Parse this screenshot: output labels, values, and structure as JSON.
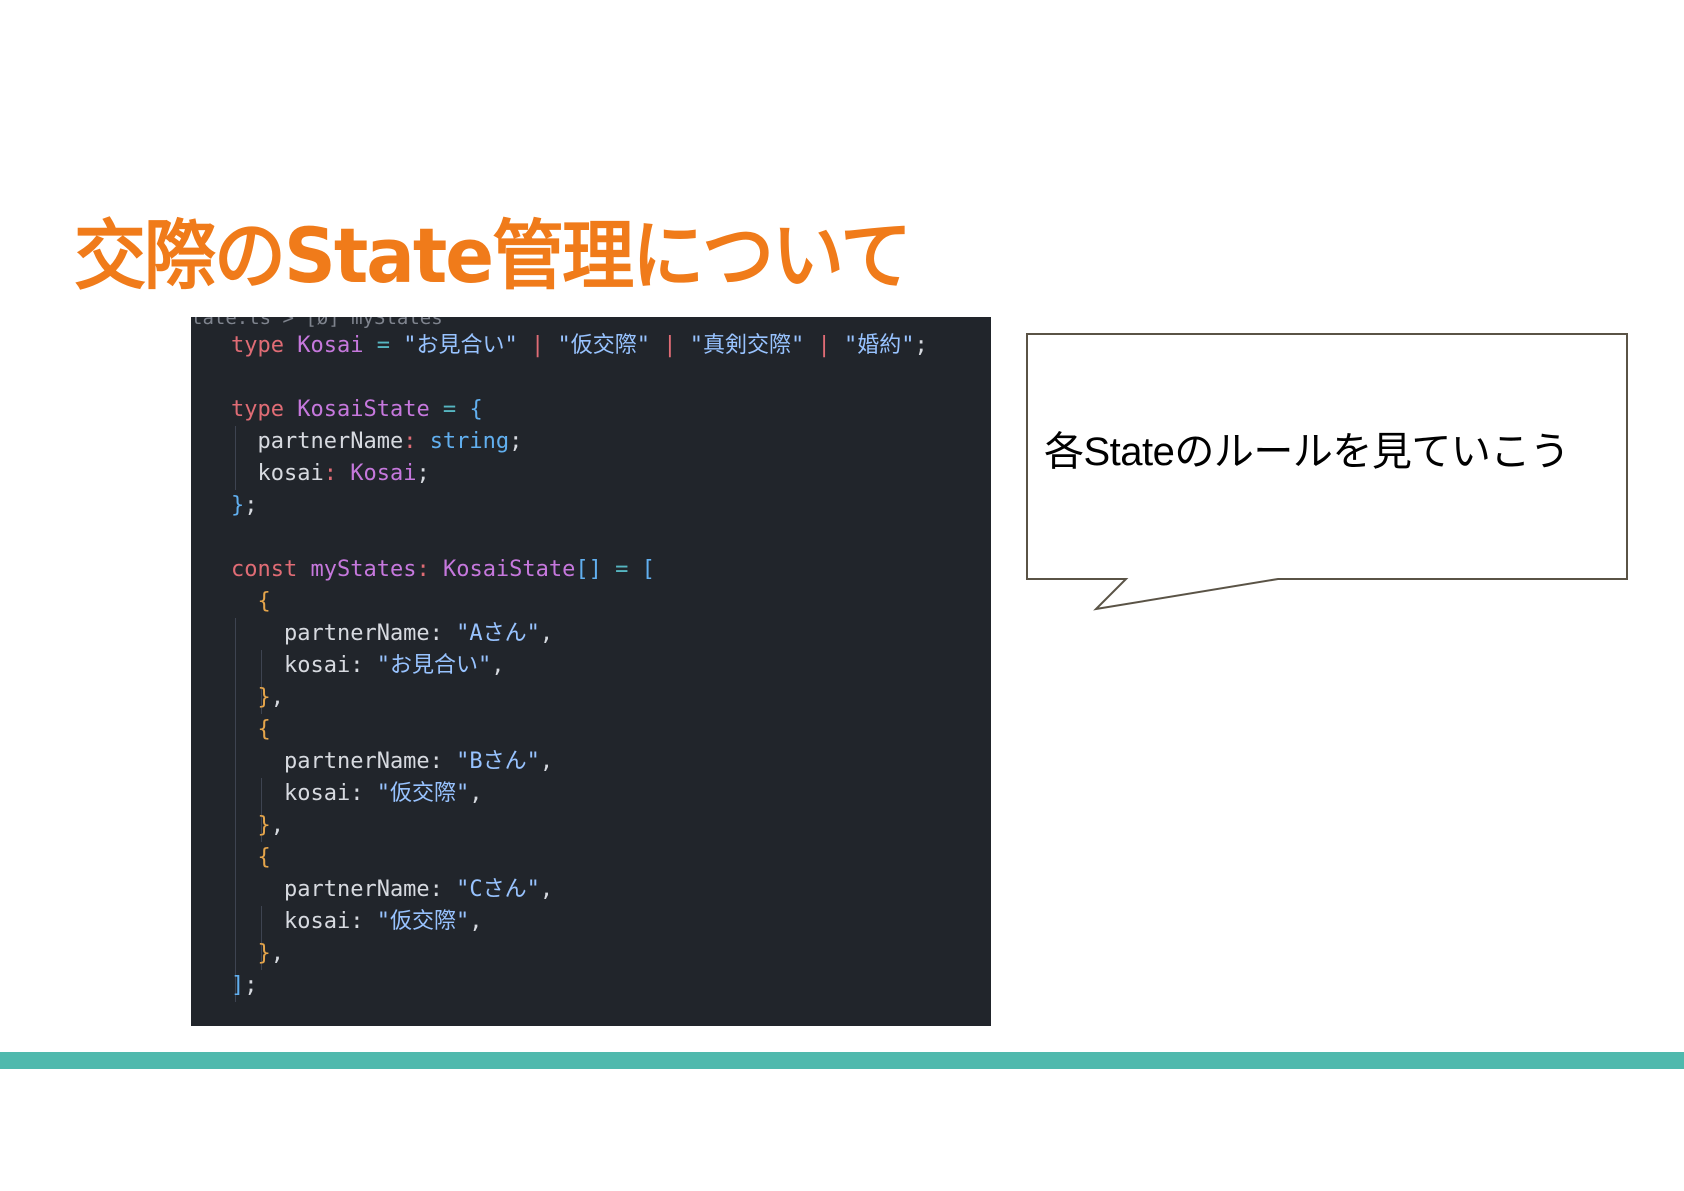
{
  "slide": {
    "title": "交際のState管理について",
    "callout_text": "各Stateのルールを見ていこう"
  },
  "code": {
    "breadcrumb": "tate.ts > [ø] myStates",
    "lines": [
      [
        [
          "type ",
          "#e06c75"
        ],
        [
          "Kosai",
          "#c678dd"
        ],
        [
          " = ",
          "#56b6c2"
        ],
        [
          "\"お見合い\"",
          "#98c3ff"
        ],
        [
          " | ",
          "#e06c75"
        ],
        [
          "\"仮交際\"",
          "#98c3ff"
        ],
        [
          " | ",
          "#e06c75"
        ],
        [
          "\"真剣交際\"",
          "#98c3ff"
        ],
        [
          " | ",
          "#e06c75"
        ],
        [
          "\"婚約\"",
          "#98c3ff"
        ],
        [
          ";",
          "#d7dae0"
        ]
      ],
      [],
      [
        [
          "type ",
          "#e06c75"
        ],
        [
          "KosaiState",
          "#c678dd"
        ],
        [
          " = ",
          "#56b6c2"
        ],
        [
          "{",
          "#61afef"
        ]
      ],
      [
        [
          "  partnerName",
          "#d7dae0"
        ],
        [
          ": ",
          "#e06c75"
        ],
        [
          "string",
          "#61afef"
        ],
        [
          ";",
          "#d7dae0"
        ]
      ],
      [
        [
          "  kosai",
          "#d7dae0"
        ],
        [
          ": ",
          "#e06c75"
        ],
        [
          "Kosai",
          "#c678dd"
        ],
        [
          ";",
          "#d7dae0"
        ]
      ],
      [
        [
          "}",
          "#61afef"
        ],
        [
          ";",
          "#d7dae0"
        ]
      ],
      [],
      [
        [
          "const ",
          "#e06c75"
        ],
        [
          "myStates",
          "#c678dd"
        ],
        [
          ": ",
          "#e06c75"
        ],
        [
          "KosaiState",
          "#c678dd"
        ],
        [
          "[]",
          "#61afef"
        ],
        [
          " = ",
          "#56b6c2"
        ],
        [
          "[",
          "#61afef"
        ]
      ],
      [
        [
          "  {",
          "#e5a54b"
        ]
      ],
      [
        [
          "    partnerName: ",
          "#d7dae0"
        ],
        [
          "\"Aさん\"",
          "#98c3ff"
        ],
        [
          ",",
          "#d7dae0"
        ]
      ],
      [
        [
          "    kosai: ",
          "#d7dae0"
        ],
        [
          "\"お見合い\"",
          "#98c3ff"
        ],
        [
          ",",
          "#d7dae0"
        ]
      ],
      [
        [
          "  }",
          "#e5a54b"
        ],
        [
          ",",
          "#d7dae0"
        ]
      ],
      [
        [
          "  {",
          "#e5a54b"
        ]
      ],
      [
        [
          "    partnerName: ",
          "#d7dae0"
        ],
        [
          "\"Bさん\"",
          "#98c3ff"
        ],
        [
          ",",
          "#d7dae0"
        ]
      ],
      [
        [
          "    kosai: ",
          "#d7dae0"
        ],
        [
          "\"仮交際\"",
          "#98c3ff"
        ],
        [
          ",",
          "#d7dae0"
        ]
      ],
      [
        [
          "  }",
          "#e5a54b"
        ],
        [
          ",",
          "#d7dae0"
        ]
      ],
      [
        [
          "  {",
          "#e5a54b"
        ]
      ],
      [
        [
          "    partnerName: ",
          "#d7dae0"
        ],
        [
          "\"Cさん\"",
          "#98c3ff"
        ],
        [
          ",",
          "#d7dae0"
        ]
      ],
      [
        [
          "    kosai: ",
          "#d7dae0"
        ],
        [
          "\"仮交際\"",
          "#98c3ff"
        ],
        [
          ",",
          "#d7dae0"
        ]
      ],
      [
        [
          "  }",
          "#e5a54b"
        ],
        [
          ",",
          "#d7dae0"
        ]
      ],
      [
        [
          "]",
          "#61afef"
        ],
        [
          ";",
          "#d7dae0"
        ]
      ]
    ],
    "highlighted_line": 19
  },
  "colors": {
    "title": "#f07b1a",
    "accent_bar": "#4fb9ad",
    "code_background": "#21252b",
    "callout_border": "#5a5346"
  }
}
